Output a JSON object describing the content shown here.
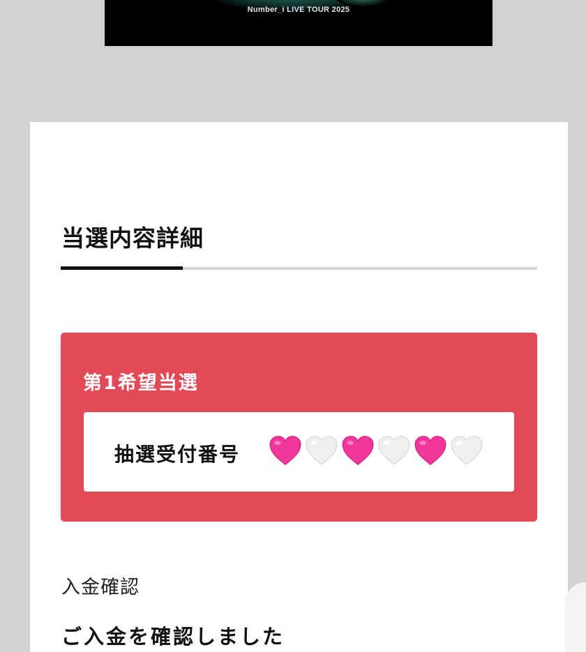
{
  "banner": {
    "text": "Number_i LIVE TOUR 2025"
  },
  "details": {
    "title": "当選内容詳細",
    "result_label": "第1希望当選",
    "entry_label": "抽選受付番号",
    "entry_number_hearts": [
      {
        "icon": "pink-heart-icon",
        "color": "#f0389b"
      },
      {
        "icon": "white-heart-icon",
        "color": "#efefef"
      },
      {
        "icon": "pink-heart-icon",
        "color": "#f0389b"
      },
      {
        "icon": "white-heart-icon",
        "color": "#efefef"
      },
      {
        "icon": "pink-heart-icon",
        "color": "#f0389b"
      },
      {
        "icon": "white-heart-icon",
        "color": "#efefef"
      }
    ]
  },
  "payment": {
    "label": "入金確認",
    "status": "ご入金を確認しました"
  },
  "colors": {
    "accent": "#e24a58",
    "background": "#d2d2d2",
    "card": "#ffffff"
  }
}
